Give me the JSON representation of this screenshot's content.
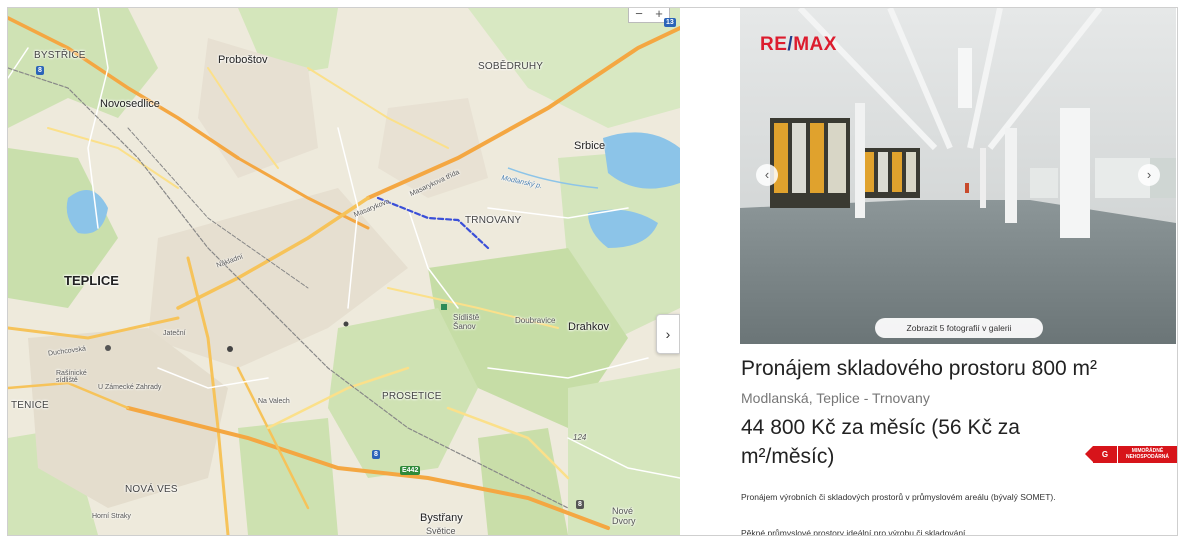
{
  "map": {
    "labels": {
      "bystrice": "BYSTŘICE",
      "probostov": "Proboštov",
      "novosedlice": "Novosedlice",
      "sobedruhy": "SOBĚDRUHY",
      "srbice": "Srbice",
      "trnovany": "TRNOVANY",
      "teplice": "TEPLICE",
      "drahkov": "Drahkov",
      "prosetice": "PROSETICE",
      "tenice": "TENICE",
      "nova_ves": "NOVÁ VES",
      "bystrany": "Bystřany",
      "svetice": "Světice",
      "nove_dvory": "Nové Dvory",
      "doubravice": "Doubravice",
      "sidliste_sanov": "Sídliště Šanov",
      "masarykova_1": "Masarykova",
      "masarykova_2": "Masarykova třída",
      "modlansky": "Modlanský p.",
      "ul_jateční": "Jateční",
      "ul_duchcovska": "Duchcovská",
      "ul_zamecke": "U Zámecké Zahrady",
      "ul_rasicke": "Rašínické sídliště",
      "ul_naklad": "Nákladní",
      "ul_na_valech": "Na Valech",
      "ul_hornistrany": "Horní Straky",
      "n_124": "124",
      "r_8a": "8",
      "r_8b": "8",
      "r_13": "13",
      "e442": "E442",
      "r_8c": "8"
    },
    "zoom_out": "−",
    "zoom_in": "+",
    "expand_icon": "›"
  },
  "listing": {
    "logo_re": "RE",
    "logo_slash": "/",
    "logo_max": "MAX",
    "gallery_button": "Zobrazit 5 fotografií v galerii",
    "prev_arrow": "‹",
    "next_arrow": "›",
    "title": "Pronájem skladového prostoru 800 m²",
    "address": "Modlanská, Teplice - Trnovany",
    "price_line1": "44 800 Kč za měsíc (56 Kč za",
    "price_line2": "m²/měsíc)",
    "energy_class": "G",
    "energy_text": "MIMOŘÁDNĚ NEHOSPODÁRNÁ",
    "description_1": "Pronájem výrobních či skladových prostorů v průmyslovém areálu (bývalý SOMET).",
    "description_2": "Pěkné průmyslové prostory ideální pro výrobu či skladování."
  },
  "colors": {
    "remax_red": "#dc1c2e",
    "remax_blue": "#1f3f8a",
    "energy_red": "#d7141a",
    "road_orange": "#f4a742",
    "water": "#8cc4e8"
  }
}
